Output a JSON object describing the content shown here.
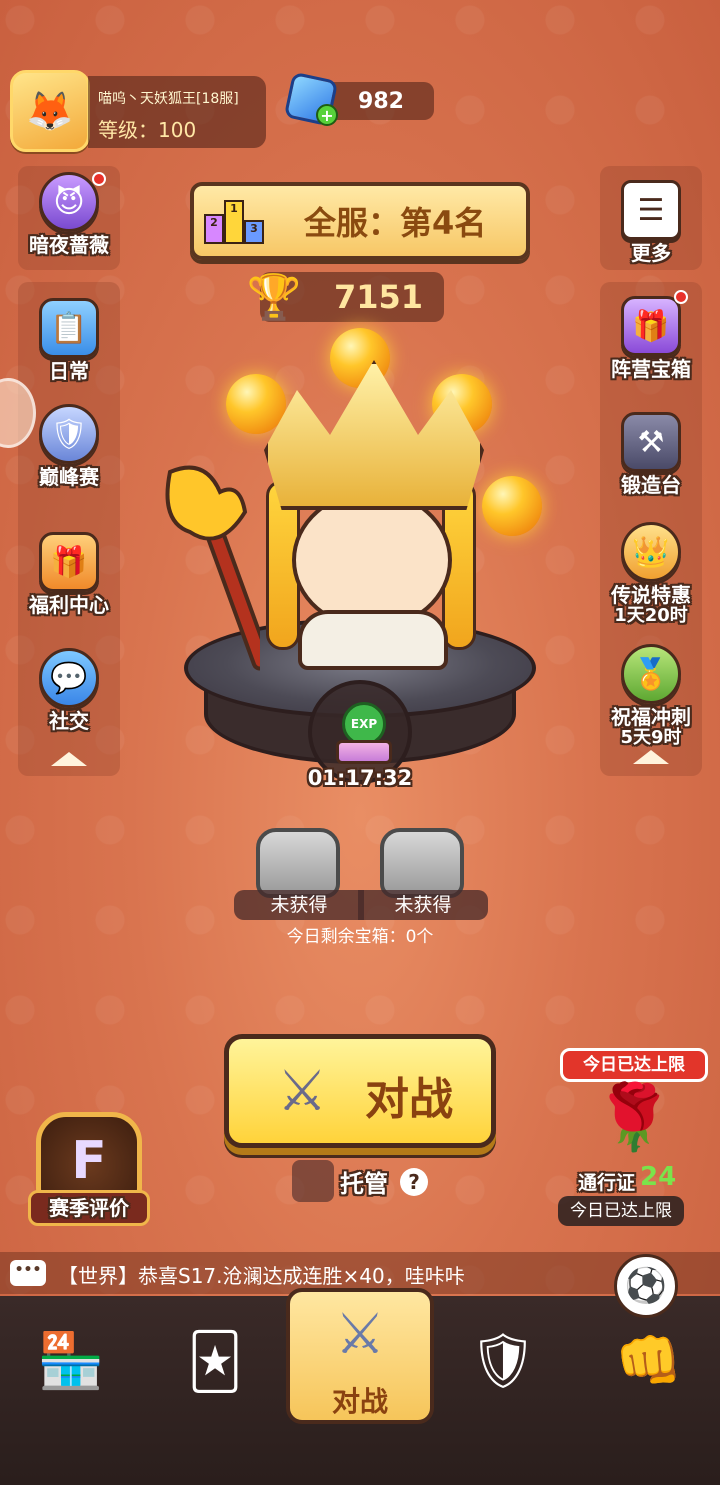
{
  "player": {
    "name": "喵呜丶天妖狐王[18服]",
    "level_text": "等级：100"
  },
  "currency": {
    "gems": "982"
  },
  "left_menu": {
    "top_item": {
      "label": "暗夜蔷薇",
      "icon": "rose-hero-icon"
    },
    "items": [
      {
        "label": "日常",
        "icon": "clipboard-icon"
      },
      {
        "label": "巅峰赛",
        "icon": "peak-badge-icon"
      },
      {
        "label": "福利中心",
        "icon": "gift-cards-icon"
      },
      {
        "label": "社交",
        "icon": "chat-face-icon"
      }
    ]
  },
  "right_menu": {
    "top_item": {
      "label": "更多",
      "icon": "menu-list-icon"
    },
    "items": [
      {
        "label": "阵营宝箱",
        "icon": "camp-chest-icon"
      },
      {
        "label": "锻造台",
        "icon": "anvil-icon"
      },
      {
        "label": "传说特惠",
        "sub": "1天20时",
        "icon": "legend-hero-icon"
      },
      {
        "label": "祝福冲刺",
        "sub": "5天9时",
        "icon": "blessing-medal-icon"
      }
    ]
  },
  "rank": {
    "title": "全服：第4名",
    "podium": [
      "2",
      "1",
      "3"
    ]
  },
  "trophies": "7151",
  "exp": {
    "badge": "EXP",
    "timer": "01:17:32"
  },
  "chests": [
    {
      "status": "未获得"
    },
    {
      "status": "未获得"
    }
  ],
  "remaining_chests": "今日剩余宝箱：0个",
  "battle": {
    "label": "对战"
  },
  "auto": {
    "label": "托管",
    "help": "?"
  },
  "season": {
    "letter": "F",
    "label": "赛季评价"
  },
  "pass": {
    "limit_top": "今日已达上限",
    "label": "通行证",
    "level": "24",
    "limit_bottom": "今日已达上限"
  },
  "chat": {
    "icon": "•••",
    "message": "【世界】恭喜S17.沧澜达成连胜×40，哇咔咔"
  },
  "bottom_nav": {
    "items": [
      {
        "icon": "shop-icon"
      },
      {
        "icon": "cards-icon"
      },
      {
        "icon": "battle-swords-icon",
        "label": "对战",
        "active": true
      },
      {
        "icon": "clan-shield-icon"
      },
      {
        "icon": "fist-icon"
      }
    ]
  },
  "colors": {
    "background": "#d9744f",
    "banner": "#f7c766",
    "battle_button": "#ffd33a",
    "red_badge": "#e2352a",
    "pass_number": "#7be34b"
  }
}
